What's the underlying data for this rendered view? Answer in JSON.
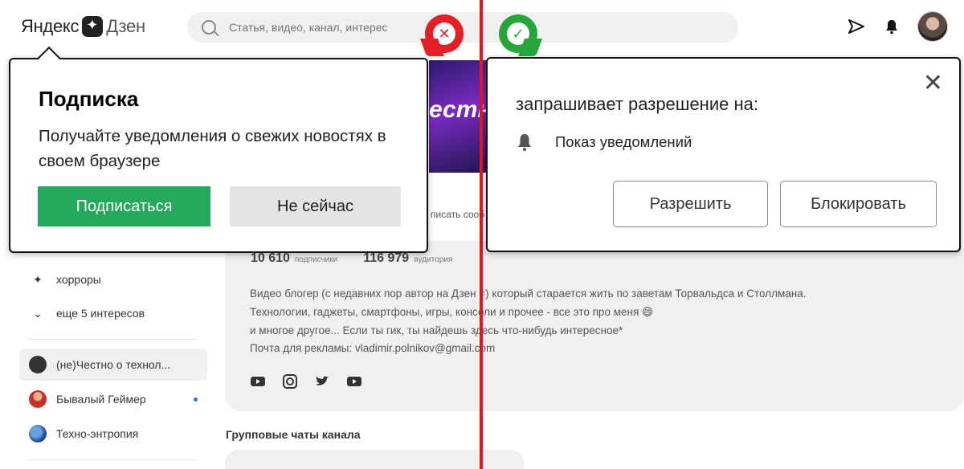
{
  "header": {
    "logo_yandex": "Яндекс",
    "logo_zen": "Дзен",
    "search_placeholder": "Статья, видео, канал, интерес"
  },
  "left_popup": {
    "title": "Подписка",
    "text": "Получайте уведомления о свежих новостях в своем браузере",
    "subscribe_label": "Подписаться",
    "later_label": "Не сейчас"
  },
  "right_popup": {
    "title": "запрашивает разрешение на:",
    "permission": "Показ уведомлений",
    "allow_label": "Разрешить",
    "block_label": "Блокировать",
    "close_glyph": "✕"
  },
  "badges": {
    "bad": "✕",
    "good": "✓"
  },
  "sidebar": {
    "items": [
      {
        "label": "хорроры"
      },
      {
        "label": "еще 5 интересов"
      },
      {
        "label": "(не)Честно о технол..."
      },
      {
        "label": "Бывалый Геймер"
      },
      {
        "label": "Техно-энтропия"
      }
    ]
  },
  "channel": {
    "subscribers_value": "10 610",
    "subscribers_label": "подписчики",
    "audience_value": "116 979",
    "audience_label": "аудитория",
    "description": [
      "Видео блогер (с недавних пор автор на Дзен =) который старается жить по заветам Торвальдса и Столлмана.",
      "Технологии, гаджеты, смартфоны, игры, консоли и прочее - все это про меня 😄",
      "и многое другое... Если ты гик, ты найдешь здесь что-нибудь интересное*",
      "Почта для рекламы: vladimir.polnikov@gmail.com"
    ],
    "cover_partial_text": "естн",
    "cover_strip_text": "писать сообщ",
    "group_chats_title": "Групповые чаты канала"
  },
  "colors": {
    "accent_green": "#23a85c",
    "split_red": "#e8141d",
    "badge_red": "#e51e26",
    "badge_green": "#26a63a"
  }
}
